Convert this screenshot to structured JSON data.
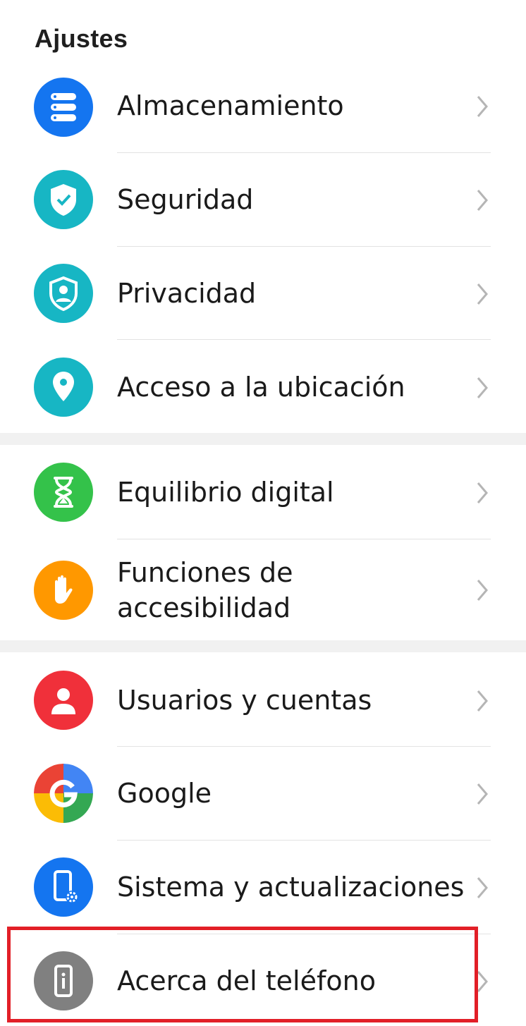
{
  "header": {
    "title": "Ajustes"
  },
  "items": [
    {
      "label": "Almacenamiento",
      "icon": "storage-icon",
      "color": "#1475f0"
    },
    {
      "label": "Seguridad",
      "icon": "shield-check-icon",
      "color": "#17b6c4"
    },
    {
      "label": "Privacidad",
      "icon": "privacy-icon",
      "color": "#17b6c4"
    },
    {
      "label": "Acceso a la ubicación",
      "icon": "location-pin-icon",
      "color": "#17b6c4"
    },
    {
      "label": "Equilibrio digital",
      "icon": "hourglass-icon",
      "color": "#34c24a"
    },
    {
      "label": "Funciones de accesibilidad",
      "icon": "hand-icon",
      "color": "#ff9800"
    },
    {
      "label": "Usuarios y cuentas",
      "icon": "user-icon",
      "color": "#f0303a"
    },
    {
      "label": "Google",
      "icon": "google-icon",
      "color": "#4285f4"
    },
    {
      "label": "Sistema y actualizaciones",
      "icon": "system-update-icon",
      "color": "#1475f0"
    },
    {
      "label": "Acerca del teléfono",
      "icon": "phone-info-icon",
      "color": "#808080"
    }
  ],
  "highlight_color": "#e21f27"
}
